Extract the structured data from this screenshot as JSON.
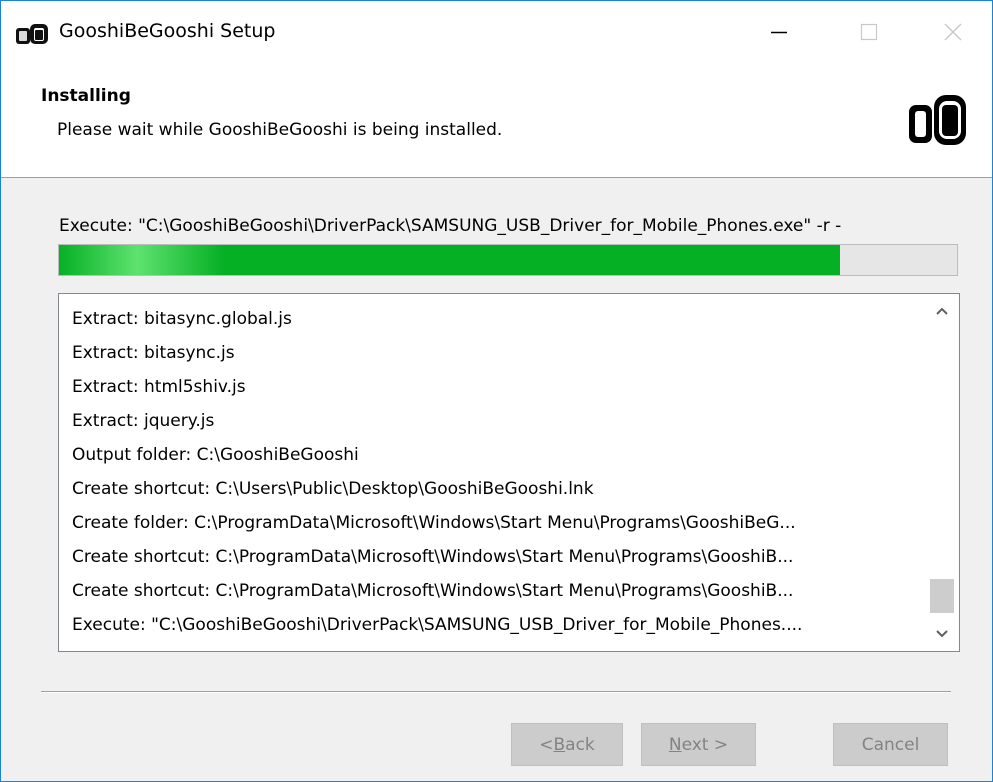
{
  "window": {
    "title": "GooshiBeGooshi Setup",
    "icons": {
      "app": "setup-app-icon",
      "minimize": "minimize-icon",
      "maximize": "maximize-icon",
      "close": "close-icon"
    }
  },
  "header": {
    "title": "Installing",
    "subtitle": "Please wait while GooshiBeGooshi is being installed."
  },
  "status": {
    "text": "Execute: \"C:\\GooshiBeGooshi\\DriverPack\\SAMSUNG_USB_Driver_for_Mobile_Phones.exe\" -r -",
    "progress_percent": 87,
    "progress_color": "#06b025"
  },
  "log": {
    "items": [
      "Extract: bitasync.global.js",
      "Extract: bitasync.js",
      "Extract: html5shiv.js",
      "Extract: jquery.js",
      "Output folder: C:\\GooshiBeGooshi",
      "Create shortcut: C:\\Users\\Public\\Desktop\\GooshiBeGooshi.lnk",
      "Create folder: C:\\ProgramData\\Microsoft\\Windows\\Start Menu\\Programs\\GooshiBeG...",
      "Create shortcut: C:\\ProgramData\\Microsoft\\Windows\\Start Menu\\Programs\\GooshiB...",
      "Create shortcut: C:\\ProgramData\\Microsoft\\Windows\\Start Menu\\Programs\\GooshiB...",
      "Execute: \"C:\\GooshiBeGooshi\\DriverPack\\SAMSUNG_USB_Driver_for_Mobile_Phones...."
    ]
  },
  "buttons": {
    "back_prefix": "< ",
    "back_accel": "B",
    "back_rest": "ack",
    "next_accel": "N",
    "next_rest": "ext >",
    "cancel": "Cancel"
  }
}
